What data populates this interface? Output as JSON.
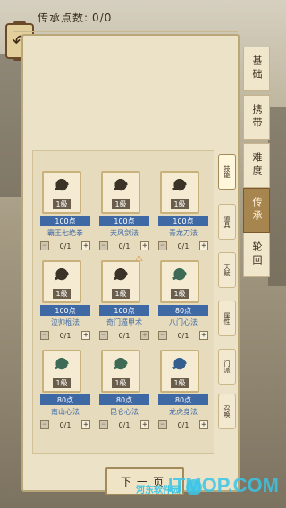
{
  "header": {
    "points_label": "传承点数:",
    "points_value": "0/0"
  },
  "side_tabs": [
    {
      "label": "基础",
      "active": false
    },
    {
      "label": "携带",
      "active": false
    },
    {
      "label": "难度",
      "active": false
    },
    {
      "label": "传承",
      "active": true
    },
    {
      "label": "轮回",
      "active": false
    }
  ],
  "sub_tabs": [
    {
      "label": "技能",
      "active": true
    },
    {
      "label": "道具",
      "active": false
    },
    {
      "label": "天赋",
      "active": false
    },
    {
      "label": "属性",
      "active": false
    },
    {
      "label": "门派",
      "active": false
    },
    {
      "label": "召唤",
      "active": false
    }
  ],
  "skills": [
    {
      "name": "霸王七绝拳",
      "cost": "100点",
      "level": "1级",
      "value": "0/1",
      "color": "dark",
      "warn": false
    },
    {
      "name": "天风剑法",
      "cost": "100点",
      "level": "1级",
      "value": "0/1",
      "color": "dark",
      "warn": false
    },
    {
      "name": "青龙刀法",
      "cost": "100点",
      "level": "1级",
      "value": "0/1",
      "color": "dark",
      "warn": false
    },
    {
      "name": "泣帅棍法",
      "cost": "100点",
      "level": "1级",
      "value": "0/1",
      "color": "dark",
      "warn": false
    },
    {
      "name": "奇门遁甲术",
      "cost": "100点",
      "level": "1级",
      "value": "0/1",
      "color": "dark",
      "warn": true
    },
    {
      "name": "八门心法",
      "cost": "80点",
      "level": "1级",
      "value": "0/1",
      "color": "green",
      "warn": false
    },
    {
      "name": "南山心法",
      "cost": "80点",
      "level": "1级",
      "value": "0/1",
      "color": "green",
      "warn": false
    },
    {
      "name": "昆仑心法",
      "cost": "80点",
      "level": "1级",
      "value": "0/1",
      "color": "green",
      "warn": false
    },
    {
      "name": "龙虎身法",
      "cost": "80点",
      "level": "1级",
      "value": "0/1",
      "color": "blue",
      "warn": false
    }
  ],
  "stepper": {
    "minus": "−",
    "plus": "+"
  },
  "footer": {
    "next_label": "下一页"
  },
  "watermark": {
    "text": "ITMOP.COM",
    "cn": "河东软件园"
  },
  "colors": {
    "cost_bg": "#3f69a5",
    "tab_active": "#a7854f",
    "panel": "#ece2c7"
  }
}
